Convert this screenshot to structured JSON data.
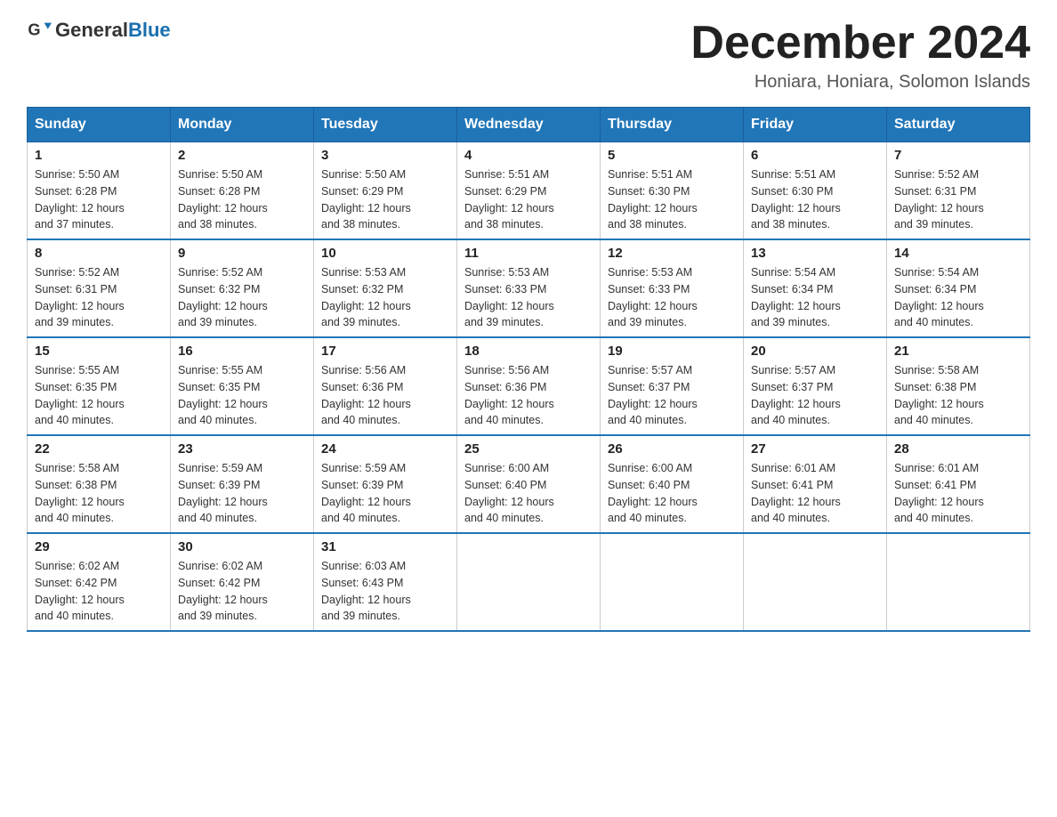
{
  "header": {
    "logo_general": "General",
    "logo_blue": "Blue",
    "title": "December 2024",
    "subtitle": "Honiara, Honiara, Solomon Islands"
  },
  "days_of_week": [
    "Sunday",
    "Monday",
    "Tuesday",
    "Wednesday",
    "Thursday",
    "Friday",
    "Saturday"
  ],
  "weeks": [
    [
      {
        "day": "1",
        "sunrise": "5:50 AM",
        "sunset": "6:28 PM",
        "daylight": "12 hours and 37 minutes."
      },
      {
        "day": "2",
        "sunrise": "5:50 AM",
        "sunset": "6:28 PM",
        "daylight": "12 hours and 38 minutes."
      },
      {
        "day": "3",
        "sunrise": "5:50 AM",
        "sunset": "6:29 PM",
        "daylight": "12 hours and 38 minutes."
      },
      {
        "day": "4",
        "sunrise": "5:51 AM",
        "sunset": "6:29 PM",
        "daylight": "12 hours and 38 minutes."
      },
      {
        "day": "5",
        "sunrise": "5:51 AM",
        "sunset": "6:30 PM",
        "daylight": "12 hours and 38 minutes."
      },
      {
        "day": "6",
        "sunrise": "5:51 AM",
        "sunset": "6:30 PM",
        "daylight": "12 hours and 38 minutes."
      },
      {
        "day": "7",
        "sunrise": "5:52 AM",
        "sunset": "6:31 PM",
        "daylight": "12 hours and 39 minutes."
      }
    ],
    [
      {
        "day": "8",
        "sunrise": "5:52 AM",
        "sunset": "6:31 PM",
        "daylight": "12 hours and 39 minutes."
      },
      {
        "day": "9",
        "sunrise": "5:52 AM",
        "sunset": "6:32 PM",
        "daylight": "12 hours and 39 minutes."
      },
      {
        "day": "10",
        "sunrise": "5:53 AM",
        "sunset": "6:32 PM",
        "daylight": "12 hours and 39 minutes."
      },
      {
        "day": "11",
        "sunrise": "5:53 AM",
        "sunset": "6:33 PM",
        "daylight": "12 hours and 39 minutes."
      },
      {
        "day": "12",
        "sunrise": "5:53 AM",
        "sunset": "6:33 PM",
        "daylight": "12 hours and 39 minutes."
      },
      {
        "day": "13",
        "sunrise": "5:54 AM",
        "sunset": "6:34 PM",
        "daylight": "12 hours and 39 minutes."
      },
      {
        "day": "14",
        "sunrise": "5:54 AM",
        "sunset": "6:34 PM",
        "daylight": "12 hours and 40 minutes."
      }
    ],
    [
      {
        "day": "15",
        "sunrise": "5:55 AM",
        "sunset": "6:35 PM",
        "daylight": "12 hours and 40 minutes."
      },
      {
        "day": "16",
        "sunrise": "5:55 AM",
        "sunset": "6:35 PM",
        "daylight": "12 hours and 40 minutes."
      },
      {
        "day": "17",
        "sunrise": "5:56 AM",
        "sunset": "6:36 PM",
        "daylight": "12 hours and 40 minutes."
      },
      {
        "day": "18",
        "sunrise": "5:56 AM",
        "sunset": "6:36 PM",
        "daylight": "12 hours and 40 minutes."
      },
      {
        "day": "19",
        "sunrise": "5:57 AM",
        "sunset": "6:37 PM",
        "daylight": "12 hours and 40 minutes."
      },
      {
        "day": "20",
        "sunrise": "5:57 AM",
        "sunset": "6:37 PM",
        "daylight": "12 hours and 40 minutes."
      },
      {
        "day": "21",
        "sunrise": "5:58 AM",
        "sunset": "6:38 PM",
        "daylight": "12 hours and 40 minutes."
      }
    ],
    [
      {
        "day": "22",
        "sunrise": "5:58 AM",
        "sunset": "6:38 PM",
        "daylight": "12 hours and 40 minutes."
      },
      {
        "day": "23",
        "sunrise": "5:59 AM",
        "sunset": "6:39 PM",
        "daylight": "12 hours and 40 minutes."
      },
      {
        "day": "24",
        "sunrise": "5:59 AM",
        "sunset": "6:39 PM",
        "daylight": "12 hours and 40 minutes."
      },
      {
        "day": "25",
        "sunrise": "6:00 AM",
        "sunset": "6:40 PM",
        "daylight": "12 hours and 40 minutes."
      },
      {
        "day": "26",
        "sunrise": "6:00 AM",
        "sunset": "6:40 PM",
        "daylight": "12 hours and 40 minutes."
      },
      {
        "day": "27",
        "sunrise": "6:01 AM",
        "sunset": "6:41 PM",
        "daylight": "12 hours and 40 minutes."
      },
      {
        "day": "28",
        "sunrise": "6:01 AM",
        "sunset": "6:41 PM",
        "daylight": "12 hours and 40 minutes."
      }
    ],
    [
      {
        "day": "29",
        "sunrise": "6:02 AM",
        "sunset": "6:42 PM",
        "daylight": "12 hours and 40 minutes."
      },
      {
        "day": "30",
        "sunrise": "6:02 AM",
        "sunset": "6:42 PM",
        "daylight": "12 hours and 39 minutes."
      },
      {
        "day": "31",
        "sunrise": "6:03 AM",
        "sunset": "6:43 PM",
        "daylight": "12 hours and 39 minutes."
      },
      null,
      null,
      null,
      null
    ]
  ],
  "labels": {
    "sunrise": "Sunrise:",
    "sunset": "Sunset:",
    "daylight": "Daylight:"
  }
}
